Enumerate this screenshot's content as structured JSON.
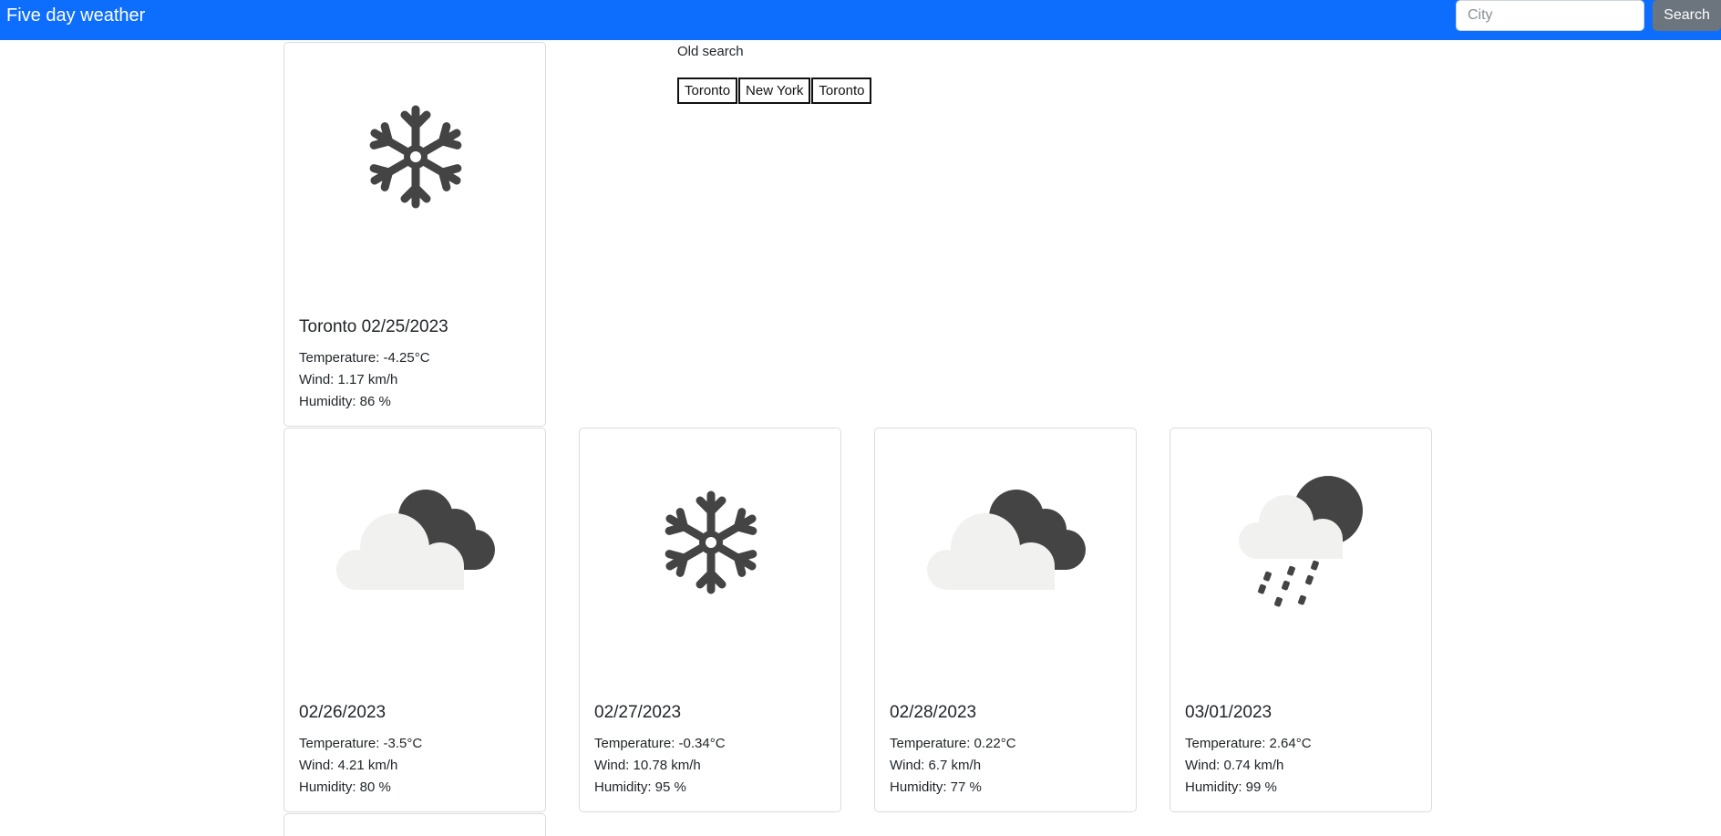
{
  "app": {
    "brand": "Five day weather",
    "search": {
      "placeholder": "City",
      "value": "",
      "button_label": "Search"
    }
  },
  "history": {
    "label": "Old search",
    "items": [
      "Toronto",
      "New York",
      "Toronto"
    ]
  },
  "cards": [
    {
      "title": "Toronto 02/25/2023",
      "icon": "snowflake-icon",
      "temperature": "Temperature: -4.25°C",
      "wind": "Wind: 1.17 km/h",
      "humidity": "Humidity: 86 %"
    },
    {
      "title": "02/26/2023",
      "icon": "cloudy-night-icon",
      "temperature": "Temperature: -3.5°C",
      "wind": "Wind: 4.21 km/h",
      "humidity": "Humidity: 80 %"
    },
    {
      "title": "02/27/2023",
      "icon": "snowflake-icon",
      "temperature": "Temperature: -0.34°C",
      "wind": "Wind: 10.78 km/h",
      "humidity": "Humidity: 95 %"
    },
    {
      "title": "02/28/2023",
      "icon": "cloudy-night-icon",
      "temperature": "Temperature: 0.22°C",
      "wind": "Wind: 6.7 km/h",
      "humidity": "Humidity: 77 %"
    },
    {
      "title": "03/01/2023",
      "icon": "snow-shower-night-icon",
      "temperature": "Temperature: 2.64°C",
      "wind": "Wind: 0.74 km/h",
      "humidity": "Humidity: 99 %"
    }
  ],
  "colors": {
    "navbar": "#0d6efd",
    "search_button": "#6c757d",
    "icon_dark": "#444444",
    "icon_cloud": "#f1f1f0"
  }
}
